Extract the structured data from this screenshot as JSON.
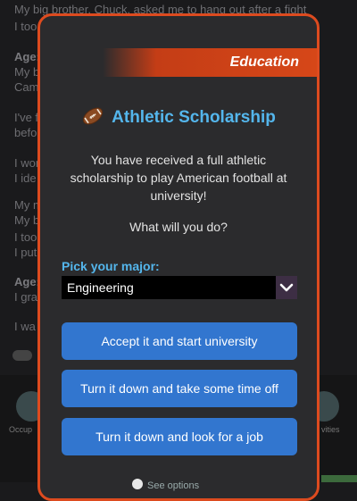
{
  "background_log": {
    "lines": [
      "My big brother, Chuck, asked me to hang out after a fight",
      "I too",
      "Age:",
      "My b",
      "Cam",
      "I've f",
      "befo",
      "I won",
      "I ide",
      "My m",
      "My b",
      "I too",
      "I put",
      "Age:",
      "I gra",
      "I wa"
    ],
    "captions": [
      "Occup",
      "vities"
    ]
  },
  "modal": {
    "category": "Education",
    "title": "Athletic Scholarship",
    "title_icon": "american-football-icon",
    "description": "You have received a full athletic scholarship to play American football at university!",
    "question": "What will you do?",
    "major_label": "Pick your major:",
    "major_selected": "Engineering",
    "buttons": [
      "Accept it and start university",
      "Turn it down and take some time off",
      "Turn it down and look for a job"
    ],
    "partial_bottom_text": "See options"
  },
  "colors": {
    "accent_orange": "#dd4b1f",
    "title_blue": "#54b6ec",
    "button_blue": "#3276cf",
    "modal_bg": "#2b2b2d"
  }
}
